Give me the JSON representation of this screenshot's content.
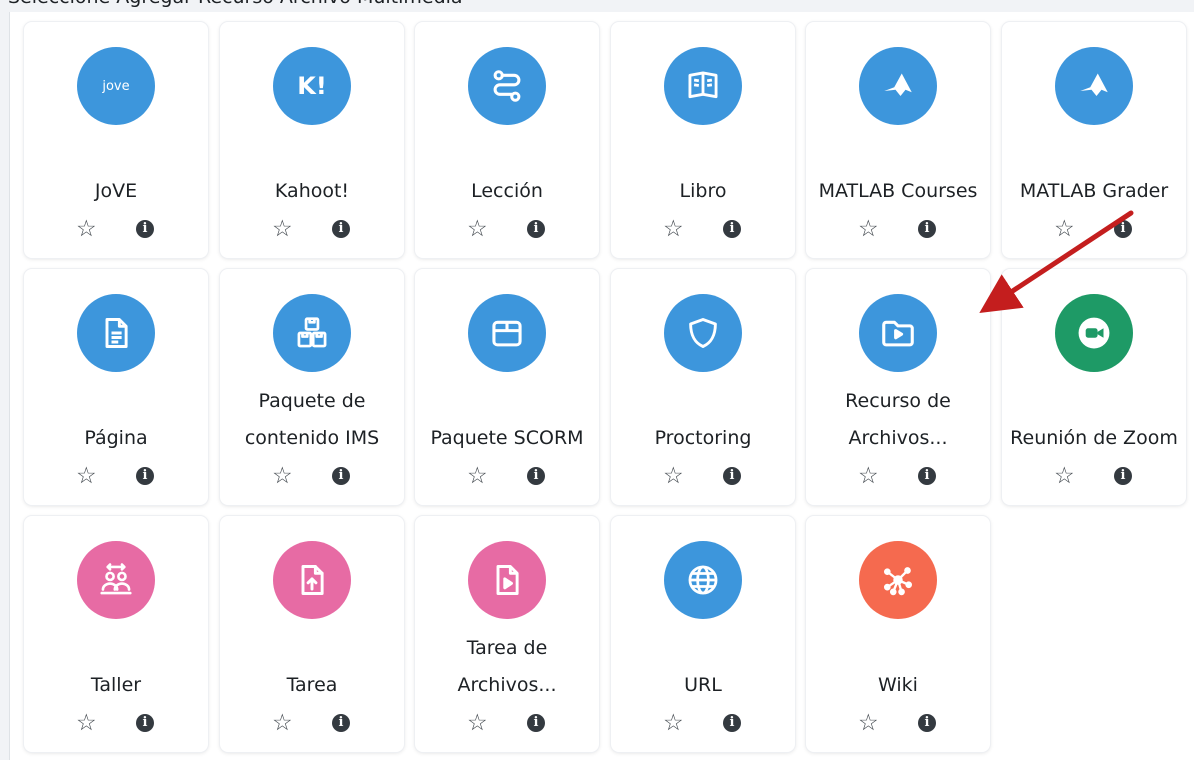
{
  "page": {
    "heading": "Seleccione Agregar Recurso Archivo Multimedia"
  },
  "colors": {
    "blue": "#3d96dc",
    "pink": "#e76ba4",
    "green": "#1e9a66",
    "coral": "#f56a4f",
    "arrow": "#c41e1e"
  },
  "modules": [
    {
      "name": "JoVE",
      "icon": "jove-logo-icon",
      "color": "#3d96dc",
      "badge": "jove"
    },
    {
      "name": "Kahoot!",
      "icon": "kahoot-logo-icon",
      "color": "#3d96dc",
      "badge": "K!"
    },
    {
      "name": "Lección",
      "icon": "lesson-path-icon",
      "color": "#3d96dc"
    },
    {
      "name": "Libro",
      "icon": "book-icon",
      "color": "#3d96dc"
    },
    {
      "name": "MATLAB Courses",
      "icon": "matlab-icon",
      "color": "#3d96dc"
    },
    {
      "name": "MATLAB Grader",
      "icon": "matlab-icon",
      "color": "#3d96dc"
    },
    {
      "name": "Página",
      "icon": "page-document-icon",
      "color": "#3d96dc"
    },
    {
      "name": "Paquete de contenido IMS",
      "icon": "ims-package-icon",
      "color": "#3d96dc"
    },
    {
      "name": "Paquete SCORM",
      "icon": "scorm-box-icon",
      "color": "#3d96dc"
    },
    {
      "name": "Proctoring",
      "icon": "shield-icon",
      "color": "#3d96dc"
    },
    {
      "name": "Recurso de Archivos...",
      "icon": "media-folder-icon",
      "color": "#3d96dc"
    },
    {
      "name": "Reunión de Zoom",
      "icon": "zoom-camera-icon",
      "color": "#1e9a66"
    },
    {
      "name": "Taller",
      "icon": "workshop-people-icon",
      "color": "#e76ba4"
    },
    {
      "name": "Tarea",
      "icon": "assignment-upload-icon",
      "color": "#e76ba4"
    },
    {
      "name": "Tarea de Archivos...",
      "icon": "media-file-icon",
      "color": "#e76ba4"
    },
    {
      "name": "URL",
      "icon": "globe-icon",
      "color": "#3d96dc"
    },
    {
      "name": "Wiki",
      "icon": "wiki-network-icon",
      "color": "#f56a4f"
    }
  ],
  "actions": {
    "star_glyph": "☆",
    "star_label": "favourite-star-icon",
    "info_glyph": "i",
    "info_label": "info-icon"
  }
}
